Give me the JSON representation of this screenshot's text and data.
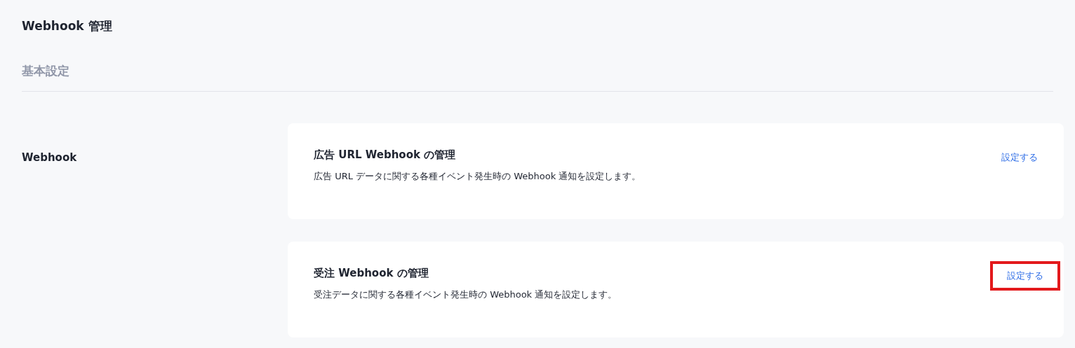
{
  "page": {
    "title": "Webhook 管理"
  },
  "section": {
    "title": "基本設定"
  },
  "group": {
    "label": "Webhook",
    "cards": [
      {
        "title": "広告 URL Webhook の管理",
        "description": "広告 URL データに関する各種イベント発生時の Webhook 通知を設定します。",
        "action": "設定する",
        "highlighted": false
      },
      {
        "title": "受注 Webhook の管理",
        "description": "受注データに関する各種イベント発生時の Webhook 通知を設定します。",
        "action": "設定する",
        "highlighted": true
      }
    ]
  }
}
